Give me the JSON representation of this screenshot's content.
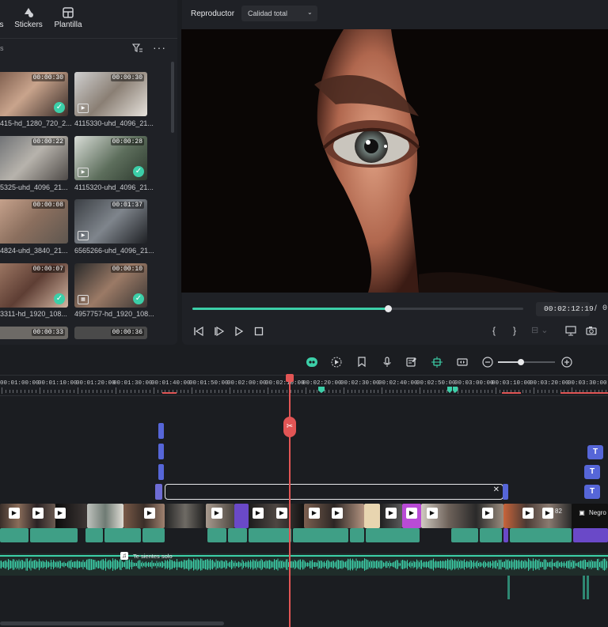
{
  "media_panel": {
    "tabs": [
      {
        "label": "Stickers",
        "icon": "sticker-icon"
      },
      {
        "label": "Plantilla",
        "icon": "template-icon"
      }
    ],
    "cropped_tab_label": "s",
    "filter_icon": "filter-icon",
    "more_icon": "more-icon",
    "search_fragment": "s",
    "clips": [
      {
        "duration": "00:00:30",
        "name": "415-hd_1280_720_2...",
        "checked": true
      },
      {
        "duration": "00:00:30",
        "name": "4115330-uhd_4096_21...",
        "checked": false
      },
      {
        "duration": "00:00:22",
        "name": "5325-uhd_4096_21...",
        "checked": false
      },
      {
        "duration": "00:00:28",
        "name": "4115320-uhd_4096_21...",
        "checked": true
      },
      {
        "duration": "00:00:08",
        "name": "4824-uhd_3840_21...",
        "checked": false
      },
      {
        "duration": "00:01:37",
        "name": "6565266-uhd_4096_21...",
        "checked": false
      },
      {
        "duration": "00:00:07",
        "name": "3311-hd_1920_108...",
        "checked": true
      },
      {
        "duration": "00:00:10",
        "name": "4957757-hd_1920_108...",
        "checked": true
      },
      {
        "duration": "00:00:33",
        "name": "",
        "checked": false
      },
      {
        "duration": "00:00:36",
        "name": "",
        "checked": false
      }
    ]
  },
  "player": {
    "label": "Reproductor",
    "quality": "Calidad total",
    "current_time": "00:02:12:19",
    "separator": "/",
    "total_fragment": "0",
    "progress": 0.59,
    "controls": [
      "prev-frame-icon",
      "next-frame-icon",
      "play-icon",
      "stop-icon"
    ],
    "right_controls": [
      "mark-in-icon",
      "mark-out-icon",
      "split-view-icon",
      "display-icon",
      "snapshot-icon"
    ],
    "mark_in": "{",
    "mark_out": "}"
  },
  "timeline": {
    "ruler": [
      "00:01:00:00",
      "00:01:10:00",
      "00:01:20:00",
      "00:01:30:00",
      "00:01:40:00",
      "00:01:50:00",
      "00:02:00:00",
      "00:02:10:00",
      "00:02:20:00",
      "00:02:30:00",
      "00:02:40:00",
      "00:02:50:00",
      "00:03:00:00",
      "00:03:10:00",
      "00:03:20:00",
      "00:03:30:00"
    ],
    "toolbar_icons": [
      "ai-icon",
      "speed-icon",
      "marker-icon",
      "mic-icon",
      "audio-edit-icon",
      "ai-cut-icon",
      "fit-icon",
      "zoom-out-icon",
      "zoom-in-icon"
    ],
    "zoom_level": 0.4,
    "title_track_label": "T",
    "audio_clip_label": "Te sientes solo",
    "black_clip_label": "Negro",
    "clip_number": "82"
  }
}
